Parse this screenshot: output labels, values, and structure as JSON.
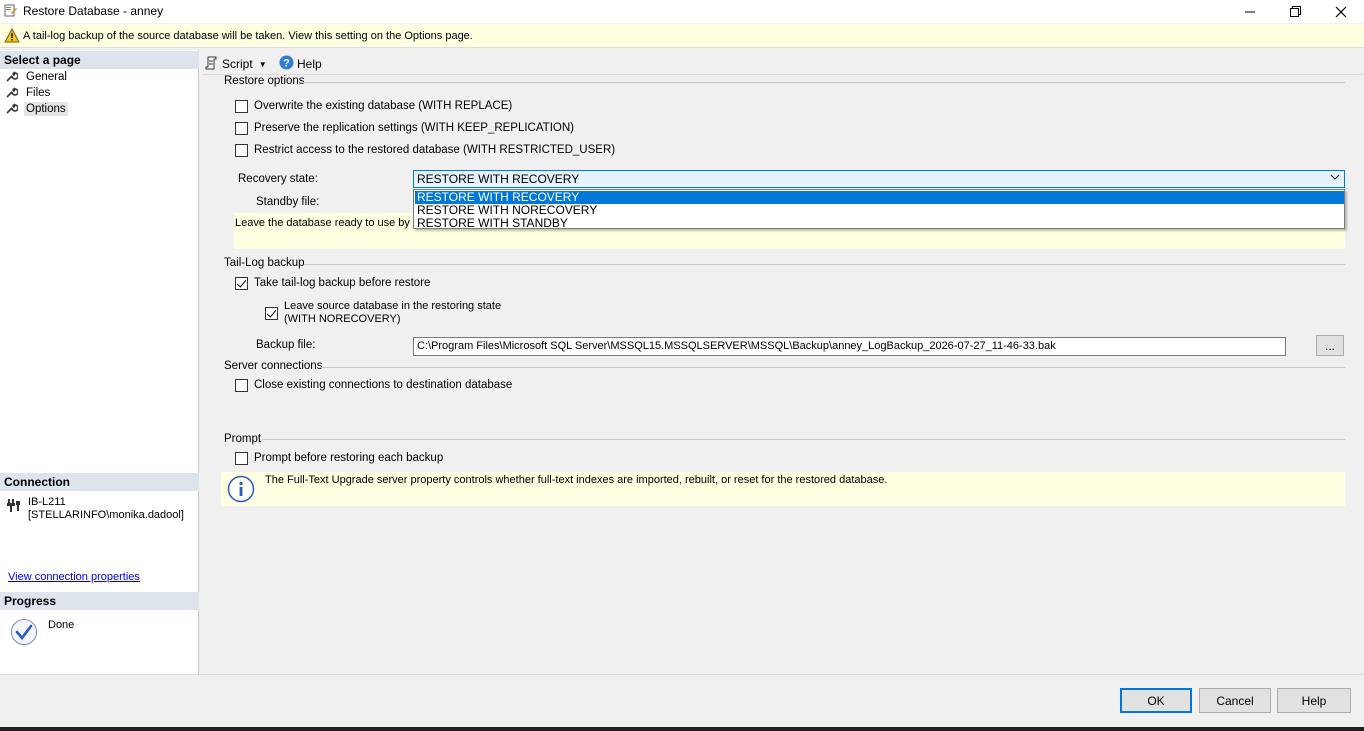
{
  "window": {
    "title": "Restore Database - anney",
    "controls": [
      "minimize",
      "restore",
      "close"
    ]
  },
  "warning": {
    "icon": "warning-icon",
    "text": "A tail-log backup of the source database will be taken. View this setting on the Options page."
  },
  "sidebar": {
    "select_page_header": "Select a page",
    "pages": [
      {
        "label": "General",
        "selected": false
      },
      {
        "label": "Files",
        "selected": false
      },
      {
        "label": "Options",
        "selected": true
      }
    ],
    "connection_header": "Connection",
    "connection_server": "IB-L211",
    "connection_user": "[STELLARINFO\\monika.dadool]",
    "view_connection_link": "View connection properties",
    "progress_header": "Progress",
    "progress_status": "Done"
  },
  "toolbar": {
    "script_label": "Script",
    "help_label": "Help"
  },
  "restore_options": {
    "header": "Restore options",
    "overwrite": {
      "label": "Overwrite the existing database (WITH REPLACE)",
      "checked": false
    },
    "preserve_replication": {
      "label": "Preserve the replication settings (WITH KEEP_REPLICATION)",
      "checked": false
    },
    "restrict_access": {
      "label": "Restrict access to the restored database (WITH RESTRICTED_USER)",
      "checked": false
    },
    "recovery_state_label": "Recovery state:",
    "recovery_state_value": "RESTORE WITH RECOVERY",
    "recovery_state_options": [
      "RESTORE WITH RECOVERY",
      "RESTORE WITH NORECOVERY",
      "RESTORE WITH STANDBY"
    ],
    "standby_file_label": "Standby file:",
    "recovery_description_visible": "Leave the database ready to use by r"
  },
  "tail_log": {
    "header": "Tail-Log backup",
    "take_tail_log": {
      "label": "Take tail-log backup before restore",
      "checked": true
    },
    "leave_restoring_line1": "Leave source database in the restoring state",
    "leave_restoring_line2": "(WITH NORECOVERY)",
    "leave_restoring_checked": true,
    "backup_file_label": "Backup file:",
    "backup_file_value": "C:\\Program Files\\Microsoft SQL Server\\MSSQL15.MSSQLSERVER\\MSSQL\\Backup\\anney_LogBackup_2026-07-27_11-46-33.bak",
    "browse_label": "..."
  },
  "server_connections": {
    "header": "Server connections",
    "close_existing": {
      "label": "Close existing connections to destination database",
      "checked": false
    }
  },
  "prompt": {
    "header": "Prompt",
    "prompt_before": {
      "label": "Prompt before restoring each backup",
      "checked": false
    }
  },
  "info": {
    "icon": "info-icon",
    "text": "The Full-Text Upgrade server property controls whether full-text indexes are imported, rebuilt, or reset for the restored database."
  },
  "buttons": {
    "ok": "OK",
    "cancel": "Cancel",
    "help": "Help"
  },
  "colors": {
    "accent": "#0078d7",
    "info_background": "#ffffe1",
    "section_header": "#dde4ec"
  }
}
